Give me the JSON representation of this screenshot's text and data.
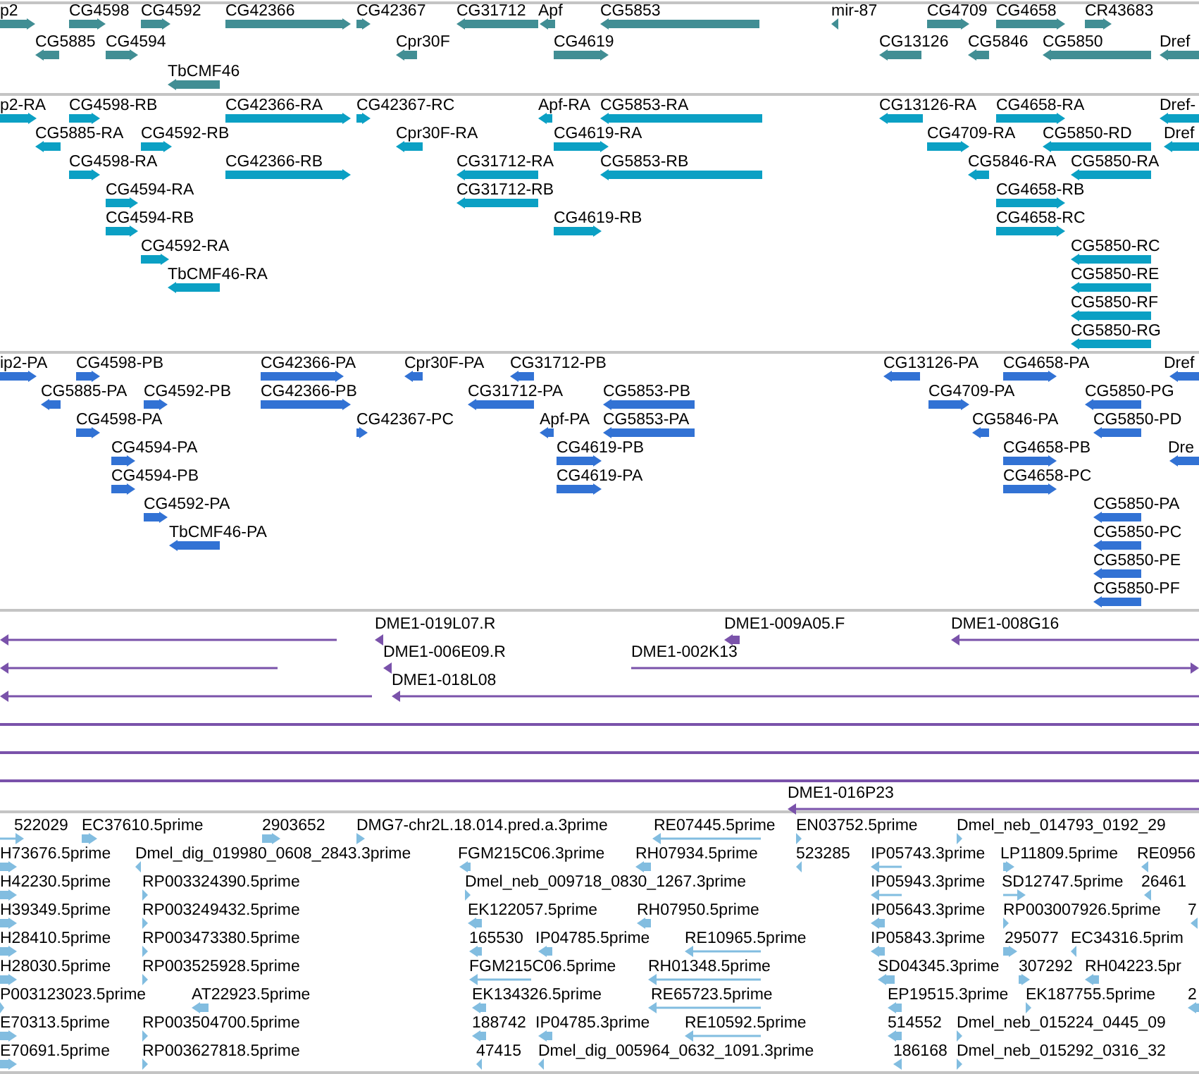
{
  "tracks": [
    {
      "color": "#418e94",
      "features": [
        {
          "label": "p2",
          "reverse": false
        },
        {
          "label": "CG4598",
          "reverse": false
        },
        {
          "label": "CG4592",
          "reverse": false
        },
        {
          "label": "CG42366",
          "reverse": false
        },
        {
          "label": "CG42367",
          "reverse": false
        },
        {
          "label": "CG31712",
          "reverse": true
        },
        {
          "label": "Apf",
          "reverse": true
        },
        {
          "label": "CG5853",
          "reverse": true
        },
        {
          "label": "mir-87",
          "reverse": true
        },
        {
          "label": "CG4709",
          "reverse": false
        },
        {
          "label": "CG4658",
          "reverse": false
        },
        {
          "label": "CR43683",
          "reverse": false
        },
        {
          "label": "CG5885",
          "reverse": true
        },
        {
          "label": "CG4594",
          "reverse": false
        },
        {
          "label": "Cpr30F",
          "reverse": true
        },
        {
          "label": "CG4619",
          "reverse": false
        },
        {
          "label": "CG13126",
          "reverse": true
        },
        {
          "label": "CG5846",
          "reverse": true
        },
        {
          "label": "CG5850",
          "reverse": true
        },
        {
          "label": "Dref",
          "reverse": true
        },
        {
          "label": "TbCMF46",
          "reverse": true
        }
      ]
    },
    {
      "color": "#0ba0c4",
      "features": [
        {
          "label": "p2-RA",
          "reverse": false
        },
        {
          "label": "CG4598-RB",
          "reverse": false
        },
        {
          "label": "CG42366-RA",
          "reverse": false
        },
        {
          "label": "CG42367-RC",
          "reverse": false
        },
        {
          "label": "Apf-RA",
          "reverse": true
        },
        {
          "label": "CG5853-RA",
          "reverse": true
        },
        {
          "label": "CG13126-RA",
          "reverse": true
        },
        {
          "label": "CG4658-RA",
          "reverse": false
        },
        {
          "label": "Dref-",
          "reverse": true
        },
        {
          "label": "CG5885-RA",
          "reverse": true
        },
        {
          "label": "CG4592-RB",
          "reverse": false
        },
        {
          "label": "Cpr30F-RA",
          "reverse": true
        },
        {
          "label": "CG4619-RA",
          "reverse": false
        },
        {
          "label": "CG4709-RA",
          "reverse": false
        },
        {
          "label": "CG5850-RD",
          "reverse": true
        },
        {
          "label": "Dref",
          "reverse": true
        },
        {
          "label": "CG4598-RA",
          "reverse": false
        },
        {
          "label": "CG42366-RB",
          "reverse": false
        },
        {
          "label": "CG31712-RA",
          "reverse": true
        },
        {
          "label": "CG5853-RB",
          "reverse": true
        },
        {
          "label": "CG5846-RA",
          "reverse": true
        },
        {
          "label": "CG5850-RA",
          "reverse": true
        },
        {
          "label": "CG4594-RA",
          "reverse": false
        },
        {
          "label": "CG31712-RB",
          "reverse": true
        },
        {
          "label": "CG4658-RB",
          "reverse": false
        },
        {
          "label": "CG4594-RB",
          "reverse": false
        },
        {
          "label": "CG4619-RB",
          "reverse": false
        },
        {
          "label": "CG4658-RC",
          "reverse": false
        },
        {
          "label": "CG4592-RA",
          "reverse": false
        },
        {
          "label": "CG5850-RC",
          "reverse": true
        },
        {
          "label": "TbCMF46-RA",
          "reverse": true
        },
        {
          "label": "CG5850-RE",
          "reverse": true
        },
        {
          "label": "CG5850-RF",
          "reverse": true
        },
        {
          "label": "CG5850-RG",
          "reverse": true
        }
      ]
    },
    {
      "color": "#3272d4",
      "features": [
        {
          "label": "ip2-PA",
          "reverse": false
        },
        {
          "label": "CG4598-PB",
          "reverse": false
        },
        {
          "label": "CG42366-PA",
          "reverse": false
        },
        {
          "label": "Cpr30F-PA",
          "reverse": true
        },
        {
          "label": "CG31712-PB",
          "reverse": true
        },
        {
          "label": "CG13126-PA",
          "reverse": true
        },
        {
          "label": "CG4658-PA",
          "reverse": false
        },
        {
          "label": "Dref",
          "reverse": true
        },
        {
          "label": "CG5885-PA",
          "reverse": true
        },
        {
          "label": "CG4592-PB",
          "reverse": false
        },
        {
          "label": "CG42366-PB",
          "reverse": false
        },
        {
          "label": "CG31712-PA",
          "reverse": true
        },
        {
          "label": "CG5853-PB",
          "reverse": true
        },
        {
          "label": "CG4709-PA",
          "reverse": false
        },
        {
          "label": "CG5850-PG",
          "reverse": true
        },
        {
          "label": "CG4598-PA",
          "reverse": false
        },
        {
          "label": "CG42367-PC",
          "reverse": false
        },
        {
          "label": "Apf-PA",
          "reverse": true
        },
        {
          "label": "CG5853-PA",
          "reverse": true
        },
        {
          "label": "CG5846-PA",
          "reverse": true
        },
        {
          "label": "CG5850-PD",
          "reverse": true
        },
        {
          "label": "CG4594-PA",
          "reverse": false
        },
        {
          "label": "CG4619-PB",
          "reverse": false
        },
        {
          "label": "CG4658-PB",
          "reverse": false
        },
        {
          "label": "Dre",
          "reverse": true
        },
        {
          "label": "CG4594-PB",
          "reverse": false
        },
        {
          "label": "CG4619-PA",
          "reverse": false
        },
        {
          "label": "CG4658-PC",
          "reverse": false
        },
        {
          "label": "CG4592-PA",
          "reverse": false
        },
        {
          "label": "CG5850-PA",
          "reverse": true
        },
        {
          "label": "TbCMF46-PA",
          "reverse": true
        },
        {
          "label": "CG5850-PC",
          "reverse": true
        },
        {
          "label": "CG5850-PE",
          "reverse": true
        },
        {
          "label": "CG5850-PF",
          "reverse": true
        }
      ]
    },
    {
      "color": "#7a52aa",
      "features": [
        {
          "label": "DME1-019L07.R",
          "reverse": true
        },
        {
          "label": "DME1-009A05.F",
          "reverse": true
        },
        {
          "label": "DME1-008G16",
          "reverse": true
        },
        {
          "label": "DME1-006E09.R",
          "reverse": true
        },
        {
          "label": "DME1-002K13",
          "reverse": false
        },
        {
          "label": "DME1-018L08",
          "reverse": true
        },
        {
          "label": "DME1-016P23",
          "reverse": true
        }
      ]
    },
    {
      "color": "#82bde0",
      "features": [
        {
          "label": "522029",
          "reverse": false
        },
        {
          "label": "EC37610.5prime",
          "reverse": false
        },
        {
          "label": "2903652",
          "reverse": false
        },
        {
          "label": "DMG7-chr2L.18.014.pred.a.3prime",
          "reverse": false
        },
        {
          "label": "RE07445.5prime",
          "reverse": true
        },
        {
          "label": "EN03752.5prime",
          "reverse": false
        },
        {
          "label": "Dmel_neb_014793_0192_29",
          "reverse": false
        },
        {
          "label": "H73676.5prime",
          "reverse": false
        },
        {
          "label": "Dmel_dig_019980_0608_2843.3prime",
          "reverse": true
        },
        {
          "label": "FGM215C06.3prime",
          "reverse": true
        },
        {
          "label": "RH07934.5prime",
          "reverse": true
        },
        {
          "label": "523285",
          "reverse": true
        },
        {
          "label": "IP05743.3prime",
          "reverse": true
        },
        {
          "label": "LP11809.5prime",
          "reverse": false
        },
        {
          "label": "RE0956",
          "reverse": true
        },
        {
          "label": "H42230.5prime",
          "reverse": false
        },
        {
          "label": "RP003324390.5prime",
          "reverse": false
        },
        {
          "label": "Dmel_neb_009718_0830_1267.3prime",
          "reverse": false
        },
        {
          "label": "IP05943.3prime",
          "reverse": true
        },
        {
          "label": "SD12747.5prime",
          "reverse": false
        },
        {
          "label": "26461",
          "reverse": true
        },
        {
          "label": "H39349.5prime",
          "reverse": false
        },
        {
          "label": "RP003249432.5prime",
          "reverse": false
        },
        {
          "label": "EK122057.5prime",
          "reverse": true
        },
        {
          "label": "RH07950.5prime",
          "reverse": true
        },
        {
          "label": "IP05643.3prime",
          "reverse": true
        },
        {
          "label": "RP003007926.5prime",
          "reverse": false
        },
        {
          "label": "7",
          "reverse": true
        },
        {
          "label": "H28410.5prime",
          "reverse": false
        },
        {
          "label": "RP003473380.5prime",
          "reverse": false
        },
        {
          "label": "165530",
          "reverse": true
        },
        {
          "label": "IP04785.5prime",
          "reverse": true
        },
        {
          "label": "RE10965.5prime",
          "reverse": true
        },
        {
          "label": "IP05843.3prime",
          "reverse": true
        },
        {
          "label": "295077",
          "reverse": false
        },
        {
          "label": "EC34316.5prim",
          "reverse": true
        },
        {
          "label": "H28030.5prime",
          "reverse": false
        },
        {
          "label": "RP003525928.5prime",
          "reverse": false
        },
        {
          "label": "FGM215C06.5prime",
          "reverse": true
        },
        {
          "label": "RH01348.5prime",
          "reverse": true
        },
        {
          "label": "SD04345.3prime",
          "reverse": true
        },
        {
          "label": "307292",
          "reverse": false
        },
        {
          "label": "RH04223.5pr",
          "reverse": true
        },
        {
          "label": "P003123023.5prime",
          "reverse": false
        },
        {
          "label": "AT22923.5prime",
          "reverse": true
        },
        {
          "label": "EK134326.5prime",
          "reverse": true
        },
        {
          "label": "RE65723.5prime",
          "reverse": true
        },
        {
          "label": "EP19515.3prime",
          "reverse": true
        },
        {
          "label": "EK187755.5prime",
          "reverse": false
        },
        {
          "label": "2",
          "reverse": true
        },
        {
          "label": "E70313.5prime",
          "reverse": false
        },
        {
          "label": "RP003504700.5prime",
          "reverse": false
        },
        {
          "label": "188742",
          "reverse": true
        },
        {
          "label": "IP04785.3prime",
          "reverse": true
        },
        {
          "label": "RE10592.5prime",
          "reverse": true
        },
        {
          "label": "514552",
          "reverse": true
        },
        {
          "label": "Dmel_neb_015224_0445_09",
          "reverse": false
        },
        {
          "label": "E70691.5prime",
          "reverse": false
        },
        {
          "label": "RP003627818.5prime",
          "reverse": false
        },
        {
          "label": "47415",
          "reverse": true
        },
        {
          "label": "Dmel_dig_005964_0632_1091.3prime",
          "reverse": true
        },
        {
          "label": "186168",
          "reverse": true
        },
        {
          "label": "Dmel_neb_015292_0316_32",
          "reverse": false
        }
      ]
    }
  ]
}
